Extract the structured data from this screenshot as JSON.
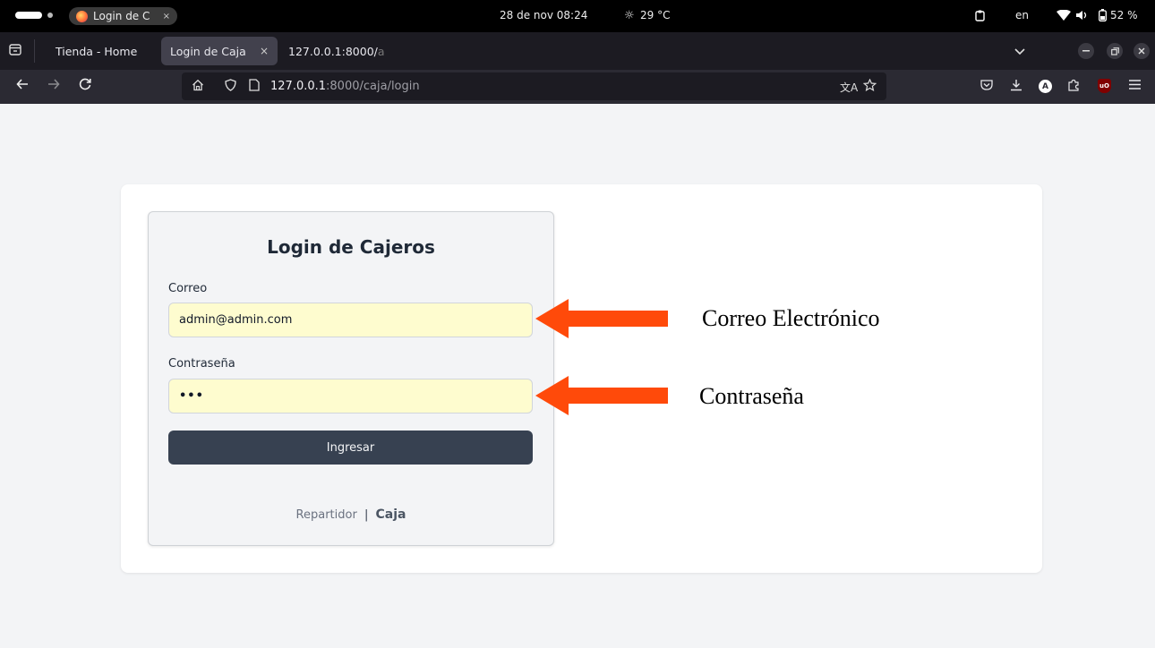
{
  "os_bar": {
    "tab_title": "Login de C",
    "tab_close": "×",
    "clock": "28 de nov  08:24",
    "weather": "29 °C",
    "weather_icon": "☼",
    "language": "en",
    "battery": "52 %"
  },
  "browser": {
    "tabs": [
      {
        "label": "Tienda - Home",
        "active": false
      },
      {
        "label": "Login de Caja",
        "active": true,
        "close": "×"
      },
      {
        "label": "127.0.0.1:8000/",
        "fade": "a",
        "active": false
      }
    ],
    "url_host": "127.0.0.1",
    "url_path": ":8000/caja/login",
    "translate_icon": "文A",
    "ext_a": "A",
    "ext_ub": "uO"
  },
  "login": {
    "title": "Login de Cajeros",
    "email_label": "Correo",
    "email_value": "admin@admin.com",
    "password_label": "Contraseña",
    "password_value": "•••",
    "submit_label": "Ingresar",
    "footer_link_1": "Repartidor",
    "footer_separator": "|",
    "footer_link_2": "Caja"
  },
  "annotations": {
    "email": "Correo Electrónico",
    "password": "Contraseña",
    "arrow_color": "#ff4a0a"
  },
  "colors": {
    "page_bg": "#f3f4f6",
    "input_bg": "#fefccf",
    "button_bg": "#374151"
  }
}
